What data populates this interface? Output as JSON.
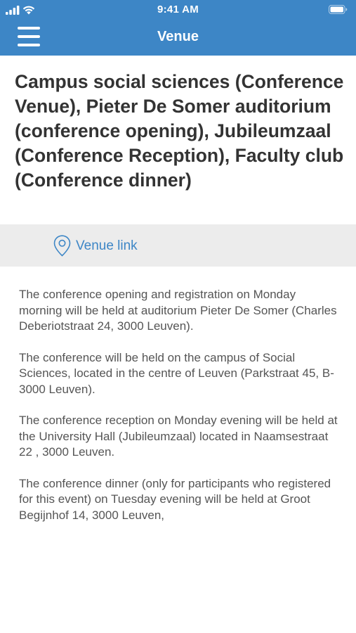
{
  "status_bar": {
    "time": "9:41 AM"
  },
  "header": {
    "title": "Venue"
  },
  "venue": {
    "title": "Campus social sciences (Conference Venue), Pieter De Somer auditorium (conference opening), Jubileumzaal (Conference Reception), Faculty club (Conference dinner)",
    "link_label": "Venue link",
    "paragraphs": [
      "The conference opening and registration on Monday morning will be held at auditorium Pieter De Somer (Charles Deberiotstraat 24, 3000 Leuven).",
      "The conference will be held on the campus of Social Sciences, located in the centre of Leuven (Parkstraat  45, B-3000 Leuven).",
      "The conference reception on Monday evening will be held at the University Hall (Jubileumzaal) located in Naamsestraat 22 , 3000 Leuven.",
      "The conference dinner (only for participants who registered for this event) on Tuesday evening will be held  at Groot Begijnhof 14, 3000 Leuven,"
    ]
  },
  "icons": {
    "menu": "hamburger-menu-icon",
    "location": "map-pin-icon",
    "signal": "cellular-signal-icon",
    "wifi": "wifi-icon",
    "battery": "battery-icon"
  },
  "colors": {
    "accent": "#3d86c6",
    "link_bar_bg": "#ececec",
    "text": "#333333"
  }
}
